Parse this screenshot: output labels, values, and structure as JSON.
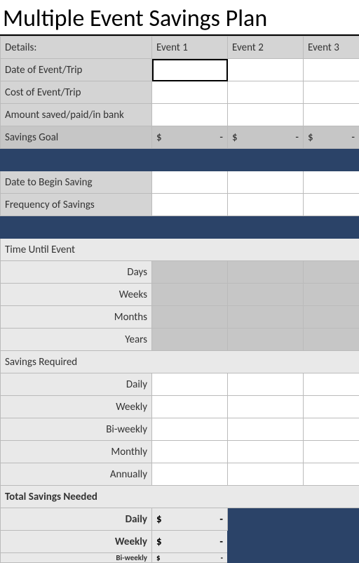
{
  "title": "Multiple Event Savings Plan",
  "header": {
    "details": "Details:",
    "e1": "Event 1",
    "e2": "Event 2",
    "e3": "Event 3"
  },
  "rows": {
    "date_of_event": "Date of Event/Trip",
    "cost_of_event": "Cost of Event/Trip",
    "amount_saved": "Amount saved/paid/in bank",
    "savings_goal": "Savings Goal",
    "date_begin": "Date to Begin Saving",
    "frequency": "Frequency of Savings"
  },
  "goal": {
    "e1": {
      "sym": "$",
      "val": "-"
    },
    "e2": {
      "sym": "$",
      "val": "-"
    },
    "e3": {
      "sym": "$",
      "val": "-"
    }
  },
  "section_time": "Time Until Event",
  "time": {
    "days": "Days",
    "weeks": "Weeks",
    "months": "Months",
    "years": "Years"
  },
  "section_req": "Savings Required",
  "req": {
    "daily": "Daily",
    "weekly": "Weekly",
    "biweekly": "Bi-weekly",
    "monthly": "Monthly",
    "annually": "Annually"
  },
  "section_total": "Total Savings Needed",
  "totals": {
    "daily": {
      "label": "Daily",
      "sym": "$",
      "val": "-"
    },
    "weekly": {
      "label": "Weekly",
      "sym": "$",
      "val": "-"
    },
    "biweekly": {
      "label": "Bi-weekly",
      "sym": "$",
      "val": "-"
    }
  }
}
